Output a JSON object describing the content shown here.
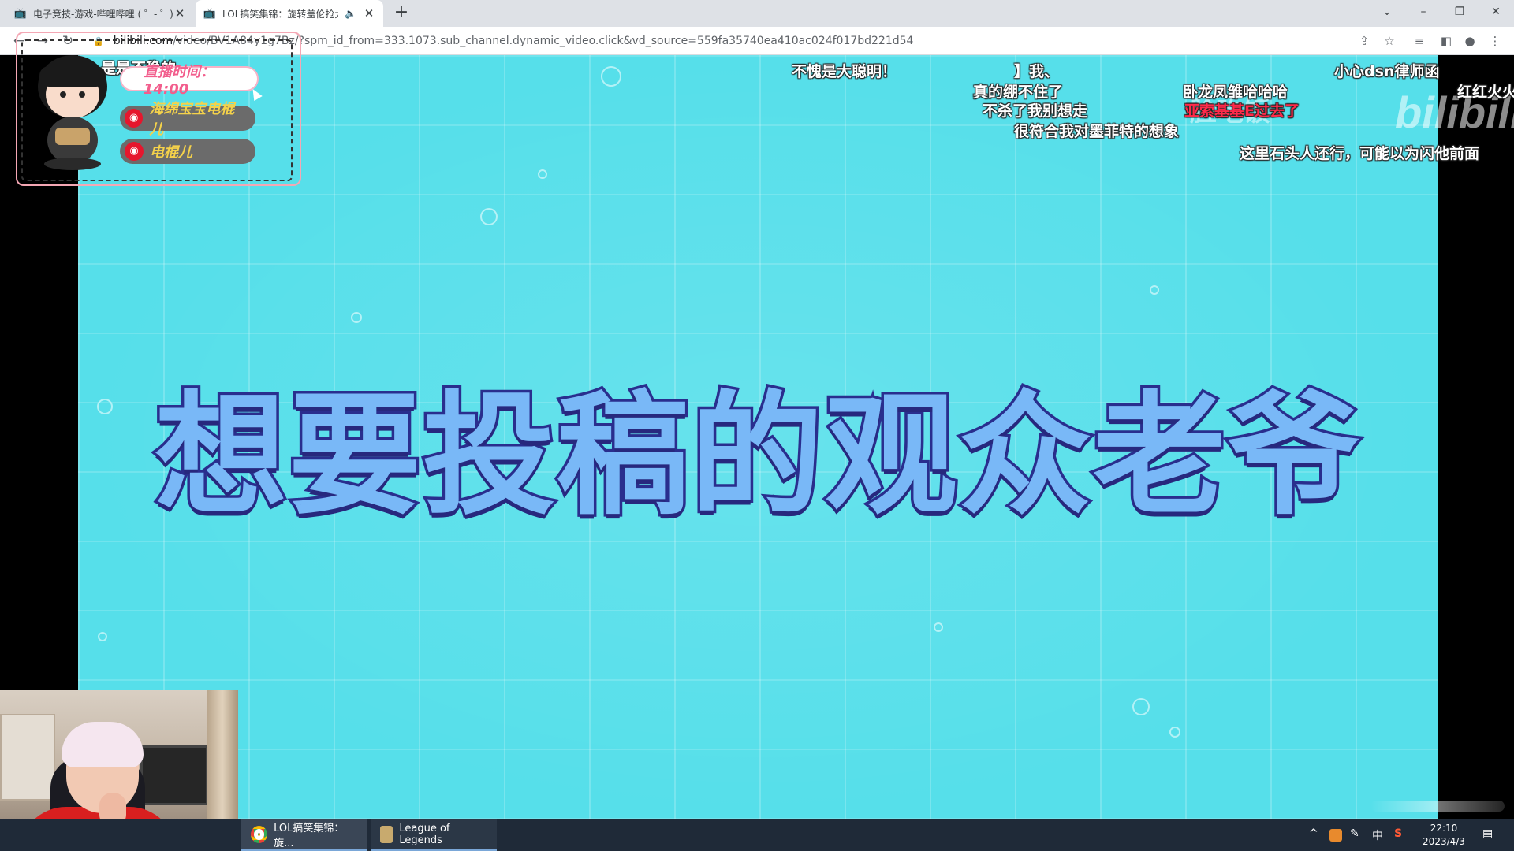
{
  "browser": {
    "tabs": [
      {
        "title": "电子竞技-游戏-哔哩哔哩 ( ゜- ゜)",
        "active": false
      },
      {
        "title": "LOL搞笑集锦：旋转盖伦抢大",
        "active": true
      }
    ],
    "new_tab": "+",
    "window_controls": {
      "menu": "⌄",
      "minimize": "–",
      "restore": "❐",
      "close": "✕"
    },
    "url": {
      "domain": "bilibili.com",
      "path": "/video/BV1A84y1g7Bz/?spm_id_from=333.1073.sub_channel.dynamic_video.click&vd_source=559fa35740ea410ac024f017bd221d54"
    },
    "nav": {
      "back": "←",
      "forward": "→",
      "reload": "↻"
    },
    "toolbar_icons": {
      "share": "⇪",
      "bookmark": "☆",
      "media": "≡",
      "sidepanel": "◧",
      "profile": "●",
      "menu": "⋮"
    }
  },
  "video": {
    "title_text": "想要投稿的观众老爷",
    "watermark": "bilibili",
    "watermark_left": "脸吃饭",
    "danmaku": [
      {
        "text": "是是不稳的",
        "color": "#ffffff"
      },
      {
        "text": "不愧是大聪明！",
        "color": "#ffffff"
      },
      {
        "text": "】我、",
        "color": "#ffffff"
      },
      {
        "text": "真的绷不住了",
        "color": "#ffffff"
      },
      {
        "text": "不杀了我别想走",
        "color": "#ffffff"
      },
      {
        "text": "很符合我对墨菲特的想象",
        "color": "#ffffff"
      },
      {
        "text": "卧龙凤雏哈哈哈",
        "color": "#ffffff"
      },
      {
        "text": "亚索基基E过去了",
        "color": "#ff2a4a"
      },
      {
        "text": "小心dsn律师函",
        "color": "#ffffff"
      },
      {
        "text": "红红火火",
        "color": "#ffffff"
      },
      {
        "text": "这里石头人还行，可能以为闪他前面",
        "color": "#ffffff"
      }
    ],
    "overlay": {
      "live_time": "直播时间：14:00",
      "weibo_1": "海绵宝宝电棍儿",
      "weibo_2": "电棍儿",
      "weibo_icon": "weibo-icon"
    }
  },
  "taskbar": {
    "apps": [
      {
        "label": "LOL搞笑集锦：旋...",
        "icon": "chrome-icon"
      },
      {
        "label": "League of Legends",
        "icon": "lol-icon"
      }
    ],
    "tray": {
      "chevron": "^",
      "ime": "中",
      "sogou": "S",
      "pen": "✎"
    },
    "time": "22:10",
    "date": "2023/4/3",
    "notification": "▤"
  },
  "colors": {
    "stage_bg": "#56dfea",
    "title_fill": "#79b8f7",
    "title_stroke": "#2a2f8e",
    "danmaku_red": "#ff2a4a",
    "taskbar": "#1f2a38"
  }
}
